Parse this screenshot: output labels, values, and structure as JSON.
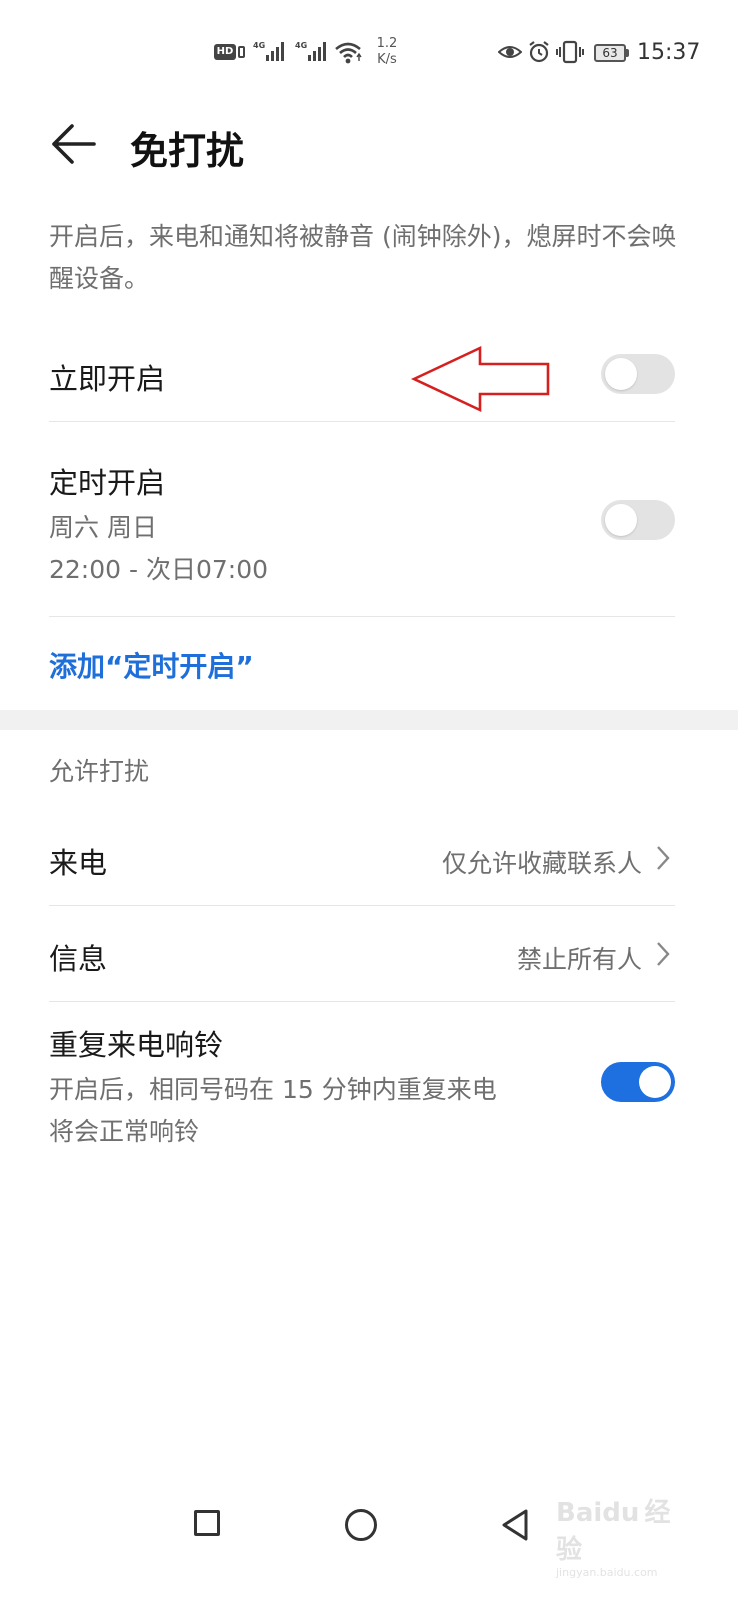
{
  "status_bar": {
    "hd_label": "HD",
    "network_1": "4G",
    "network_2": "4G",
    "speed_value": "1.2",
    "speed_unit": "K/s",
    "battery": "63",
    "time": "15:37"
  },
  "header": {
    "title": "免打扰"
  },
  "description": "开启后，来电和通知将被静音 (闹钟除外)，熄屏时不会唤醒设备。",
  "immediate": {
    "label": "立即开启",
    "enabled": false
  },
  "scheduled": {
    "label": "定时开启",
    "days": "周六 周日",
    "time_range": "22:00 - 次日07:00",
    "enabled": false
  },
  "add_schedule_label": "添加“定时开启”",
  "allow_section": {
    "title": "允许打扰",
    "calls": {
      "label": "来电",
      "value": "仅允许收藏联系人"
    },
    "messages": {
      "label": "信息",
      "value": "禁止所有人"
    },
    "repeat_calls": {
      "label": "重复来电响铃",
      "description_line1": "开启后，相同号码在 15 分钟内重复来电",
      "description_line2": "将会正常响铃",
      "enabled": true
    }
  },
  "navigation": {
    "recent_icon": "square-icon",
    "home_icon": "circle-icon",
    "back_icon": "triangle-back-icon"
  },
  "watermark": {
    "brand": "Baidu",
    "suffix": "经验",
    "domain": "jingyan.baidu.com"
  },
  "colors": {
    "accent": "#1e6fd9",
    "toggle_on": "#1e6fe0",
    "annotation_arrow": "#d62020"
  }
}
